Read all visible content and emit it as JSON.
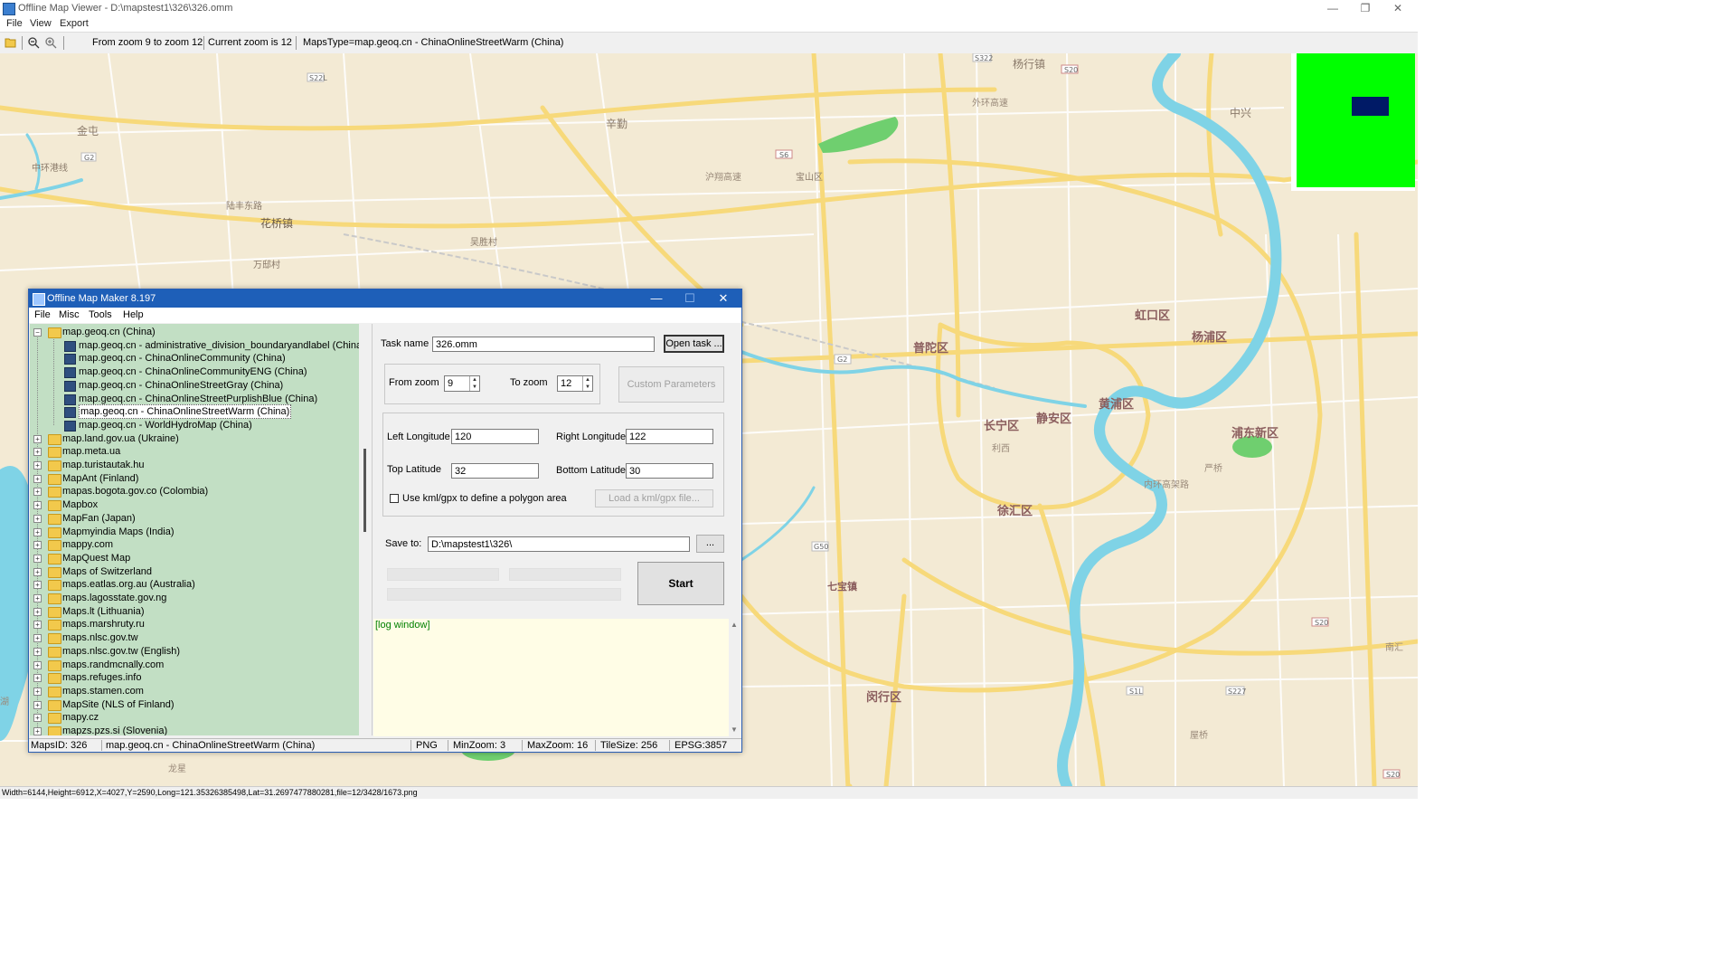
{
  "window": {
    "title": "Offline Map Viewer - D:\\mapstest1\\326\\326.omm",
    "controls": {
      "minimize": "—",
      "restore": "❐",
      "close": "✕"
    }
  },
  "menu": {
    "file": "File",
    "view": "View",
    "export": "Export"
  },
  "toolbar": {
    "zoom_range": "From zoom 9 to zoom 12",
    "current_zoom": "Current zoom is 12",
    "maps_type": "MapsType=map.geoq.cn - ChinaOnlineStreetWarm (China)"
  },
  "map": {
    "labels": [
      {
        "text": "杨行镇"
      },
      {
        "text": "辛勤"
      },
      {
        "text": "中兴"
      },
      {
        "text": "金屯"
      },
      {
        "text": "中环港线"
      },
      {
        "text": "陆丰东路"
      },
      {
        "text": "花桥镇"
      },
      {
        "text": "万邸村"
      },
      {
        "text": "吴胜村"
      },
      {
        "text": "宝山区"
      },
      {
        "text": "普陀区"
      },
      {
        "text": "虹口区"
      },
      {
        "text": "杨浦区"
      },
      {
        "text": "长宁区"
      },
      {
        "text": "静安区"
      },
      {
        "text": "黄浦区"
      },
      {
        "text": "浦东新区"
      },
      {
        "text": "徐汇区"
      },
      {
        "text": "七宝镇"
      },
      {
        "text": "闵行区"
      },
      {
        "text": "外环高速"
      },
      {
        "text": "沪翔高速"
      },
      {
        "text": "内环高架路"
      },
      {
        "text": "利西"
      },
      {
        "text": "严桥"
      },
      {
        "text": "南汇"
      },
      {
        "text": "屋桥"
      },
      {
        "text": "龙星"
      },
      {
        "text": "湖"
      }
    ],
    "shields": [
      "S22L",
      "G2",
      "S322",
      "S20",
      "S6",
      "G2",
      "G50",
      "S20",
      "S227",
      "S1L",
      "S20"
    ]
  },
  "minimap": {
    "bg_color": "#00ff00",
    "view_color": "#001a66"
  },
  "status_bar": "Width=6144,Height=6912,X=4027,Y=2590,Long=121.35326385498,Lat=31.2697477880281,file=12/3428/1673.png",
  "dialog": {
    "title": "Offline Map Maker 8.197",
    "menu": {
      "file": "File",
      "misc": "Misc",
      "tools": "Tools",
      "help": "Help"
    },
    "tree": [
      {
        "label": "map.geoq.cn (China)",
        "level": 0,
        "expanded": true,
        "icon": "folder-open-icon"
      },
      {
        "label": "map.geoq.cn - administrative_division_boundaryandlabel (China)",
        "level": 1,
        "icon": "map-icon"
      },
      {
        "label": "map.geoq.cn - ChinaOnlineCommunity (China)",
        "level": 1,
        "icon": "map-icon"
      },
      {
        "label": "map.geoq.cn - ChinaOnlineCommunityENG (China)",
        "level": 1,
        "icon": "map-icon"
      },
      {
        "label": "map.geoq.cn - ChinaOnlineStreetGray (China)",
        "level": 1,
        "icon": "map-icon"
      },
      {
        "label": "map.geoq.cn - ChinaOnlineStreetPurplishBlue (China)",
        "level": 1,
        "icon": "map-icon"
      },
      {
        "label": "map.geoq.cn - ChinaOnlineStreetWarm (China)",
        "level": 1,
        "icon": "map-icon",
        "selected": true
      },
      {
        "label": "map.geoq.cn - WorldHydroMap (China)",
        "level": 1,
        "icon": "map-icon"
      },
      {
        "label": "map.land.gov.ua (Ukraine)",
        "level": 0,
        "icon": "folder-icon"
      },
      {
        "label": "map.meta.ua",
        "level": 0,
        "icon": "folder-icon"
      },
      {
        "label": "map.turistautak.hu",
        "level": 0,
        "icon": "folder-icon"
      },
      {
        "label": "MapAnt (Finland)",
        "level": 0,
        "icon": "folder-icon"
      },
      {
        "label": "mapas.bogota.gov.co (Colombia)",
        "level": 0,
        "icon": "folder-icon"
      },
      {
        "label": "Mapbox",
        "level": 0,
        "icon": "folder-icon"
      },
      {
        "label": "MapFan (Japan)",
        "level": 0,
        "icon": "folder-icon"
      },
      {
        "label": "Mapmyindia Maps (India)",
        "level": 0,
        "icon": "folder-icon"
      },
      {
        "label": "mappy.com",
        "level": 0,
        "icon": "folder-icon"
      },
      {
        "label": "MapQuest Map",
        "level": 0,
        "icon": "folder-icon"
      },
      {
        "label": "Maps of Switzerland",
        "level": 0,
        "icon": "folder-icon"
      },
      {
        "label": "maps.eatlas.org.au (Australia)",
        "level": 0,
        "icon": "folder-icon"
      },
      {
        "label": "maps.lagosstate.gov.ng",
        "level": 0,
        "icon": "folder-icon"
      },
      {
        "label": "Maps.lt (Lithuania)",
        "level": 0,
        "icon": "folder-icon"
      },
      {
        "label": "maps.marshruty.ru",
        "level": 0,
        "icon": "folder-icon"
      },
      {
        "label": "maps.nlsc.gov.tw",
        "level": 0,
        "icon": "folder-icon"
      },
      {
        "label": "maps.nlsc.gov.tw (English)",
        "level": 0,
        "icon": "folder-icon"
      },
      {
        "label": "maps.randmcnally.com",
        "level": 0,
        "icon": "folder-icon"
      },
      {
        "label": "maps.refuges.info",
        "level": 0,
        "icon": "folder-icon"
      },
      {
        "label": "maps.stamen.com",
        "level": 0,
        "icon": "folder-icon"
      },
      {
        "label": "MapSite (NLS of Finland)",
        "level": 0,
        "icon": "folder-icon"
      },
      {
        "label": "mapy.cz",
        "level": 0,
        "icon": "folder-icon"
      },
      {
        "label": "mapzs.pzs.si (Slovenia)",
        "level": 0,
        "icon": "folder-icon"
      }
    ],
    "task_name_label": "Task name",
    "task_name_value": "326.omm",
    "open_task": "Open task ...",
    "from_zoom_label": "From zoom",
    "from_zoom_value": "9",
    "to_zoom_label": "To zoom",
    "to_zoom_value": "12",
    "custom_params": "Custom Parameters",
    "left_lon_label": "Left Longitude",
    "left_lon_value": "120",
    "right_lon_label": "Right Longitude",
    "right_lon_value": "122",
    "top_lat_label": "Top Latitude",
    "top_lat_value": "32",
    "bottom_lat_label": "Bottom Latitude",
    "bottom_lat_value": "30",
    "kml_label": "Use kml/gpx to define a polygon area",
    "kml_checked": false,
    "load_kml": "Load a kml/gpx file...",
    "save_to_label": "Save to:",
    "save_to_value": "D:\\mapstest1\\326\\",
    "browse": "...",
    "start": "Start",
    "progress": [
      0,
      0,
      0
    ],
    "log": "[log window]",
    "status": {
      "maps_id": "MapsID: 326",
      "maps_name": "map.geoq.cn - ChinaOnlineStreetWarm (China)",
      "format": "PNG",
      "min_zoom": "MinZoom: 3",
      "max_zoom": "MaxZoom: 16",
      "tile_size": "TileSize: 256",
      "epsg": "EPSG:3857"
    }
  }
}
